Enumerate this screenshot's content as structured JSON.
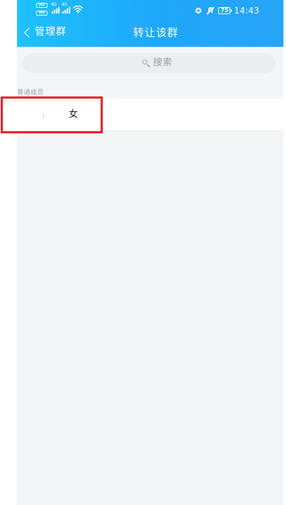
{
  "status_bar": {
    "hd1": "HD",
    "hd2": "HD",
    "signal1_label": "4G",
    "signal2_label": "4G",
    "battery_level": "75",
    "time": "14:43",
    "icons": [
      "hd-icon",
      "signal-icon",
      "wifi-icon",
      "alarm-icon",
      "mute-icon",
      "battery-icon"
    ]
  },
  "header": {
    "back_label": "管理群",
    "title": "转让该群",
    "gradient_start": "#1fc0fb",
    "gradient_end": "#27a4f7"
  },
  "search": {
    "placeholder": "搜索",
    "icon": "search-icon"
  },
  "section": {
    "label": "普通成员"
  },
  "members": [
    {
      "name": "女"
    }
  ],
  "highlight": {
    "color": "#ee1c25"
  }
}
